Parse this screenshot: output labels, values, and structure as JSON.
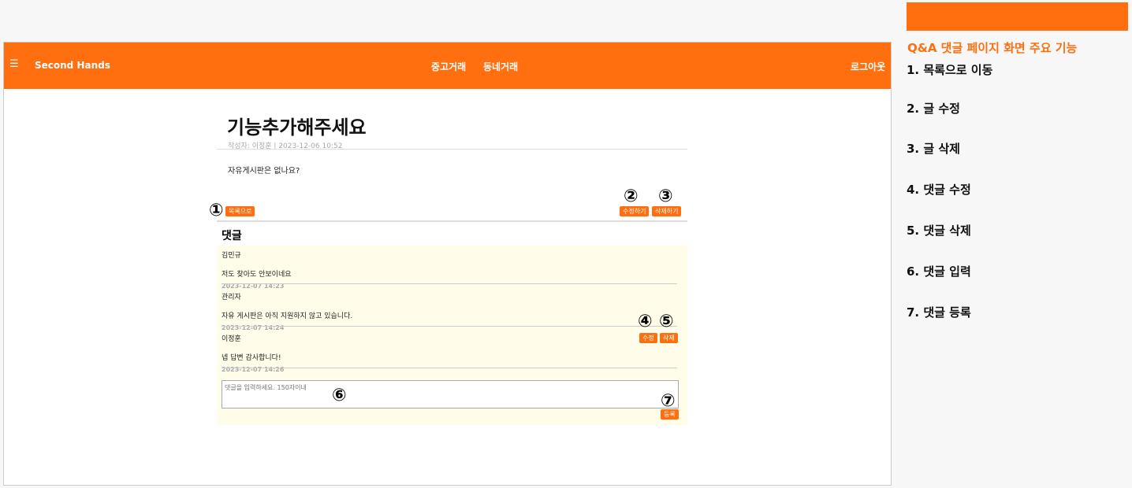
{
  "header": {
    "menu_icon": "☰",
    "brand": "Second Hands",
    "nav": [
      "중고거래",
      "동네거래"
    ],
    "logout": "로그아웃"
  },
  "post": {
    "title": "기능추가해주세요",
    "meta": "작성자: 이정훈 | 2023-12-06 10:52",
    "body": "자유게시판은 없나요?",
    "list_btn": "목록으로",
    "edit_btn": "수정하기",
    "delete_btn": "삭제하기"
  },
  "comments": {
    "heading": "댓글",
    "items": [
      {
        "author": "김민규",
        "text": "저도 찾아도 안보이네요",
        "date": "2023-12-07 14:23"
      },
      {
        "author": "관리자",
        "text": "자유 게시판은 아직 지원하지 않고 있습니다.",
        "date": "2023-12-07 14:24"
      },
      {
        "author": "이정훈",
        "text": "넵 답변 감사합니다!",
        "date": "2023-12-07 14:26"
      }
    ],
    "edit_btn": "수정",
    "delete_btn": "삭제",
    "placeholder": "댓글을 입력하세요. 150자이내",
    "submit_btn": "등록"
  },
  "markers": [
    "①",
    "②",
    "③",
    "④",
    "⑤",
    "⑥",
    "⑦"
  ],
  "side": {
    "title": "Q&A 댓글 페이지 화면 주요 기능",
    "items": [
      "1. 목록으로 이동",
      "2. 글 수정",
      "3. 글 삭제",
      "4. 댓글 수정",
      "5. 댓글 삭제",
      "6. 댓글 입력",
      "7. 댓글 등록"
    ]
  }
}
